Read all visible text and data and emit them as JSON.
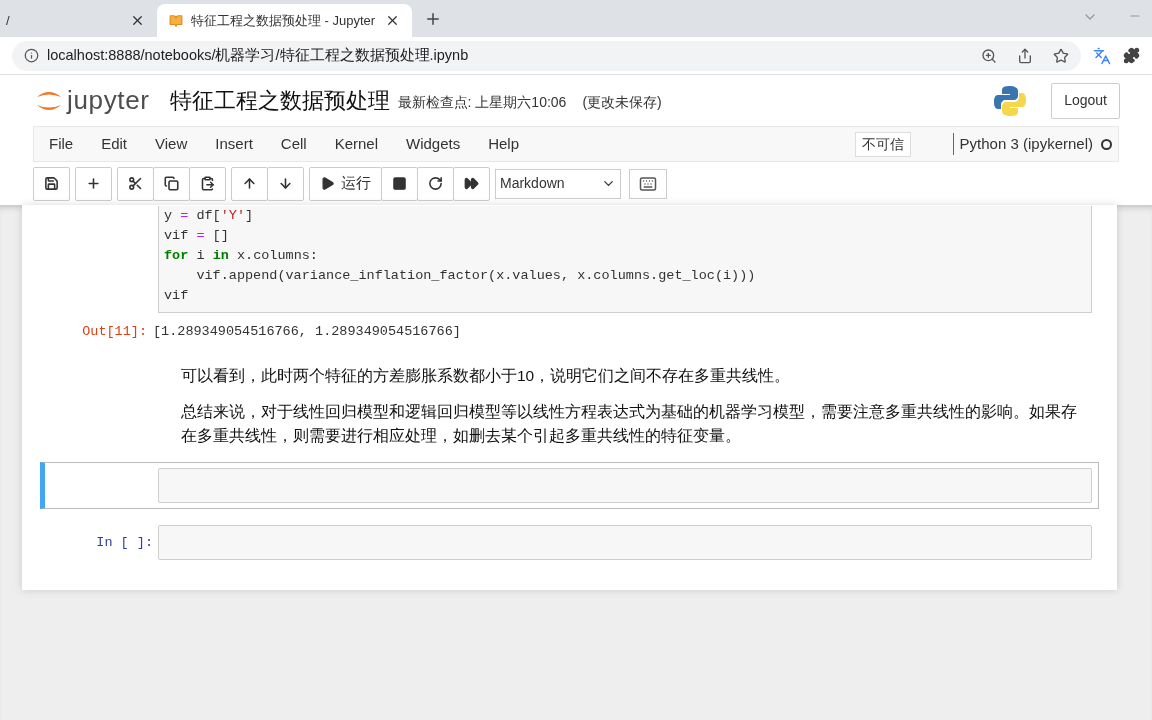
{
  "browser": {
    "tabs": [
      {
        "label": "/",
        "selected": false
      },
      {
        "label": "特征工程之数据预处理 - Jupyter",
        "selected": true
      }
    ],
    "url": "localhost:8888/notebooks/机器学习/特征工程之数据预处理.ipynb"
  },
  "header": {
    "logo_text": "jupyter",
    "title": "特征工程之数据预处理",
    "checkpoint": "最新检查点: 上星期六10:06",
    "save_status": "(更改未保存)",
    "logout": "Logout"
  },
  "menu": [
    "File",
    "Edit",
    "View",
    "Insert",
    "Cell",
    "Kernel",
    "Widgets",
    "Help"
  ],
  "trust": "不可信",
  "kernel": {
    "name": "Python 3 (ipykernel)",
    "busy": false
  },
  "toolbar": [
    [
      {
        "kind": "save"
      }
    ],
    [
      {
        "kind": "add"
      }
    ],
    [
      {
        "kind": "cut"
      },
      {
        "kind": "copy"
      },
      {
        "kind": "paste"
      }
    ],
    [
      {
        "kind": "up"
      },
      {
        "kind": "down"
      }
    ],
    [
      {
        "kind": "run",
        "label": "运行"
      },
      {
        "kind": "stop"
      },
      {
        "kind": "restart"
      },
      {
        "kind": "run-all"
      }
    ]
  ],
  "cell_type": "Markdown",
  "cells": [
    {
      "kind": "code",
      "selected": false,
      "lines": [
        [
          {
            "t": "y ",
            "kind": "plain"
          },
          {
            "t": "=",
            "kind": "op"
          },
          {
            "t": " df[",
            "kind": "plain"
          },
          {
            "t": "'Y'",
            "kind": "string"
          },
          {
            "t": "]",
            "kind": "plain"
          }
        ],
        [
          {
            "t": "vif ",
            "kind": "plain"
          },
          {
            "t": "=",
            "kind": "op"
          },
          {
            "t": " []",
            "kind": "plain"
          }
        ],
        [
          {
            "t": "for",
            "kind": "keyword"
          },
          {
            "t": " i ",
            "kind": "plain"
          },
          {
            "t": "in",
            "kind": "keyword"
          },
          {
            "t": " x.columns:",
            "kind": "plain"
          }
        ],
        [
          {
            "t": "    vif.append(variance_inflation_factor(x.values, x.columns.get_loc(i)))",
            "kind": "plain"
          }
        ],
        [
          {
            "t": "vif",
            "kind": "plain"
          }
        ]
      ]
    },
    {
      "kind": "output",
      "prompt": "Out[11]:",
      "text": "[1.289349054516766, 1.289349054516766]"
    },
    {
      "kind": "markdown",
      "paragraphs": [
        "可以看到，此时两个特征的方差膨胀系数都小于10，说明它们之间不存在多重共线性。",
        "总结来说，对于线性回归模型和逻辑回归模型等以线性方程表达式为基础的机器学习模型，需要注意多重共线性的影响。如果存在多重共线性，则需要进行相应处理，如删去某个引起多重共线性的特征变量。"
      ]
    },
    {
      "kind": "input",
      "selected": true
    },
    {
      "kind": "input",
      "selected": false,
      "prompt": "In [ ]:"
    }
  ]
}
